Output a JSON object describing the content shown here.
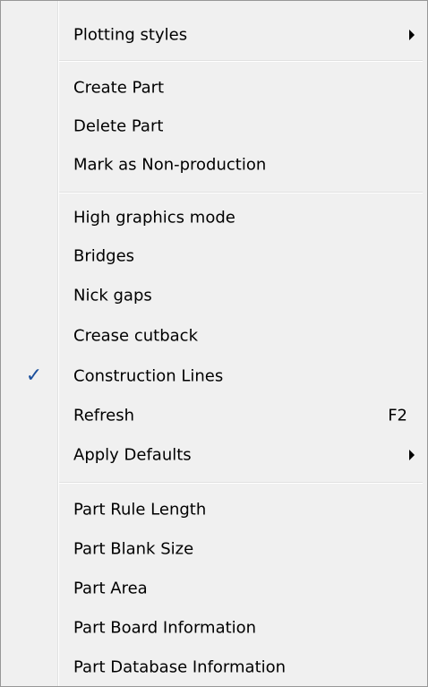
{
  "menu": {
    "items": [
      {
        "label": "Plotting styles",
        "submenu": true
      },
      {
        "label": "Create Part"
      },
      {
        "label": "Delete Part"
      },
      {
        "label": "Mark as Non-production"
      },
      {
        "label": "High graphics mode"
      },
      {
        "label": "Bridges"
      },
      {
        "label": "Nick gaps"
      },
      {
        "label": "Crease cutback"
      },
      {
        "label": "Construction Lines",
        "checked": true
      },
      {
        "label": "Refresh",
        "shortcut": "F2"
      },
      {
        "label": "Apply Defaults",
        "submenu": true
      },
      {
        "label": "Part Rule Length"
      },
      {
        "label": "Part Blank Size"
      },
      {
        "label": "Part Area"
      },
      {
        "label": "Part Board Information"
      },
      {
        "label": "Part Database Information"
      }
    ],
    "check_glyph": "✓",
    "colors": {
      "background": "#f0f0f0",
      "border": "#979797",
      "check": "#1b4f9c",
      "separator": "#e0e0e0"
    },
    "icons": {
      "check": "check-icon",
      "submenu": "submenu-arrow-icon"
    }
  }
}
